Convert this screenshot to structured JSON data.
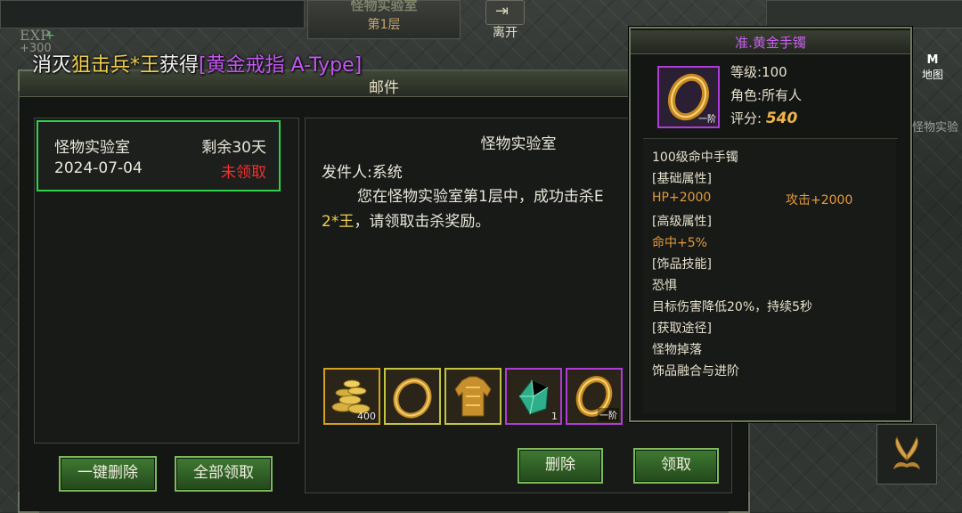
{
  "hud": {
    "top_title": "怪物实验室",
    "top_floor": "第1层",
    "leave_label": "离开",
    "exp_label": "EXP",
    "exp_plus": "+",
    "exp_value": "+300",
    "map_key": "M",
    "map_label": "地图",
    "side_text": "怪物实验"
  },
  "notice": {
    "prefix": "消灭",
    "monster": "狙击兵*王",
    "middle": "获得",
    "item": "[黄金戒指 A-Type]"
  },
  "mail": {
    "title": "邮件",
    "list": [
      {
        "name": "怪物实验室",
        "remaining": "剩余30天",
        "date": "2024-07-04",
        "status": "未领取"
      }
    ],
    "content": {
      "title": "怪物实验室",
      "sender": "发件人:系统",
      "body_line1": "您在怪物实验室第1层中，成功击杀E",
      "body_hl": "2*王",
      "body_line2_rest": "，请领取击杀奖励。"
    },
    "attachments": [
      {
        "icon": "gold-coins-icon",
        "qty": "400",
        "rarity": "orange"
      },
      {
        "icon": "gold-ring-icon",
        "qty": "",
        "rarity": "yellow"
      },
      {
        "icon": "gold-armor-icon",
        "qty": "",
        "rarity": "yellow"
      },
      {
        "icon": "green-gem-icon",
        "qty": "1",
        "rarity": "purple"
      },
      {
        "icon": "gold-bracelet-icon",
        "qty": "一阶",
        "rarity": "purple"
      }
    ],
    "buttons": {
      "delete_all": "一键删除",
      "claim_all": "全部领取",
      "delete": "删除",
      "claim": "领取"
    }
  },
  "tooltip": {
    "title": "准.黄金手镯",
    "icon_rank": "一阶",
    "level": "等级:100",
    "role": "角色:所有人",
    "score_label": "评分:",
    "score_value": "540",
    "desc": "100级命中手镯",
    "basic_header": "[基础属性]",
    "hp": "HP+2000",
    "attack": "攻击+2000",
    "advanced_header": "[高级属性]",
    "hit": "命中+5%",
    "skill_header": "[饰品技能]",
    "skill_name": "恐惧",
    "skill_desc": "目标伤害降低20%，持续5秒",
    "source_header": "[获取途径]",
    "source1": "怪物掉落",
    "source2": "饰品融合与进阶"
  }
}
